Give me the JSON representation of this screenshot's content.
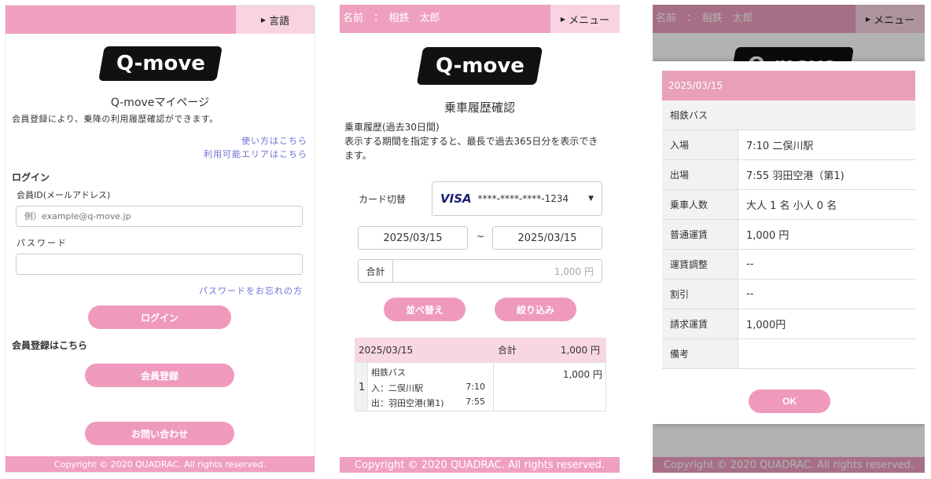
{
  "screen1": {
    "lang_label": "言語",
    "logo": "Q-move",
    "title": "Q-moveマイページ",
    "desc": "会員登録により、乗降の利用履歴確認ができます。",
    "link_howto": "使い方はこちら",
    "link_area": "利用可能エリアはこちら",
    "login_heading": "ログイン",
    "id_label": "会員ID(メールアドレス)",
    "id_placeholder": "例）example@q-move.jp",
    "pw_label": "パスワード",
    "pw_value": "",
    "forgot_link": "パスワードをお忘れの方",
    "login_button": "ログイン",
    "register_heading": "会員登録はこちら",
    "register_button": "会員登録",
    "contact_button": "お問い合わせ",
    "footer": "Copyright © 2020 QUADRAC. All rights reserved."
  },
  "screen2": {
    "name_label": "名前　：　相鉄　太郎",
    "menu_label": "メニュー",
    "logo": "Q-move",
    "title": "乗車履歴確認",
    "desc_line1": "乗車履歴(過去30日間)",
    "desc_line2": "表示する期間を指定すると、最長で過去365日分を表示でき",
    "desc_line3": "ます。",
    "card_label": "カード切替",
    "card_brand": "VISA",
    "card_number": "****-****-****-1234",
    "date_from": "2025/03/15",
    "date_sep": "~",
    "date_to": "2025/03/15",
    "total_label": "合計",
    "total_value": "1,000 円",
    "sort_button": "並べ替え",
    "filter_button": "絞り込み",
    "group": {
      "date": "2025/03/15",
      "total_label": "合計",
      "total_value": "1,000 円",
      "rows": [
        {
          "index": "1",
          "operator": "相鉄バス",
          "in_label": "入：二俣川駅",
          "in_time": "7:10",
          "out_label": "出：羽田空港(第1)",
          "out_time": "7:55",
          "fare": "1,000 円"
        }
      ]
    },
    "footer": "Copyright © 2020 QUADRAC. All rights reserved."
  },
  "screen3": {
    "name_label": "名前　：　相鉄　太郎",
    "menu_label": "メニュー",
    "logo": "Q-move",
    "modal": {
      "date": "2025/03/15",
      "operator": "相鉄バス",
      "rows": [
        {
          "label": "入場",
          "value": "7:10 二俣川駅"
        },
        {
          "label": "出場",
          "value": "7:55 羽田空港（第1)"
        },
        {
          "label": "乗車人数",
          "value": "大人 1 名  小人 0 名"
        },
        {
          "label": "普通運賃",
          "value": "1,000 円"
        },
        {
          "label": "運賃調整",
          "value": "--"
        },
        {
          "label": "割引",
          "value": "--"
        },
        {
          "label": "請求運賃",
          "value": "1,000円"
        },
        {
          "label": "備考",
          "value": ""
        }
      ],
      "ok_button": "OK"
    },
    "footer": "Copyright © 2020 QUADRAC. All rights reserved."
  },
  "colors": {
    "pink": "#f0a0bf",
    "pink_light": "#f8d3e1",
    "button_pink": "#ef9abc",
    "link_blue": "#6b70d6"
  }
}
